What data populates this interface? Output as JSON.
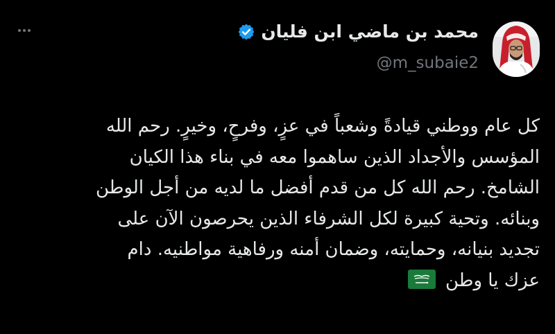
{
  "header": {
    "display_name": "محمد بن ماضي ابن فليان",
    "handle": "@m_subaie2",
    "verified_icon": "verified-badge-icon",
    "verified_color": "#1d9bf0",
    "more_icon": "more-options-icon",
    "avatar_icon": "profile-avatar"
  },
  "tweet": {
    "lines": [
      "كل عام ووطني قيادةً وشعباً في عزٍ، وفرحٍ، وخيرٍ. رحم الله",
      "المؤسس والأجداد الذين ساهموا معه في بناء هذا الكيان",
      "الشامخ. رحم الله كل من قدم أفضل ما لديه من أجل الوطن",
      "وبنائه. وتحية كبيرة لكل الشرفاء الذين يحرصون الآن على",
      "تجديد بنيانه، وحمايته، وضمان أمنه ورفاهية مواطنيه. دام",
      "عزك يا وطن"
    ],
    "emoji": "saudi-arabia-flag-emoji",
    "emoji_color": "#1a7a3a"
  },
  "colors": {
    "background": "#000000",
    "text": "#e7e9ea",
    "secondary": "#71767b"
  }
}
